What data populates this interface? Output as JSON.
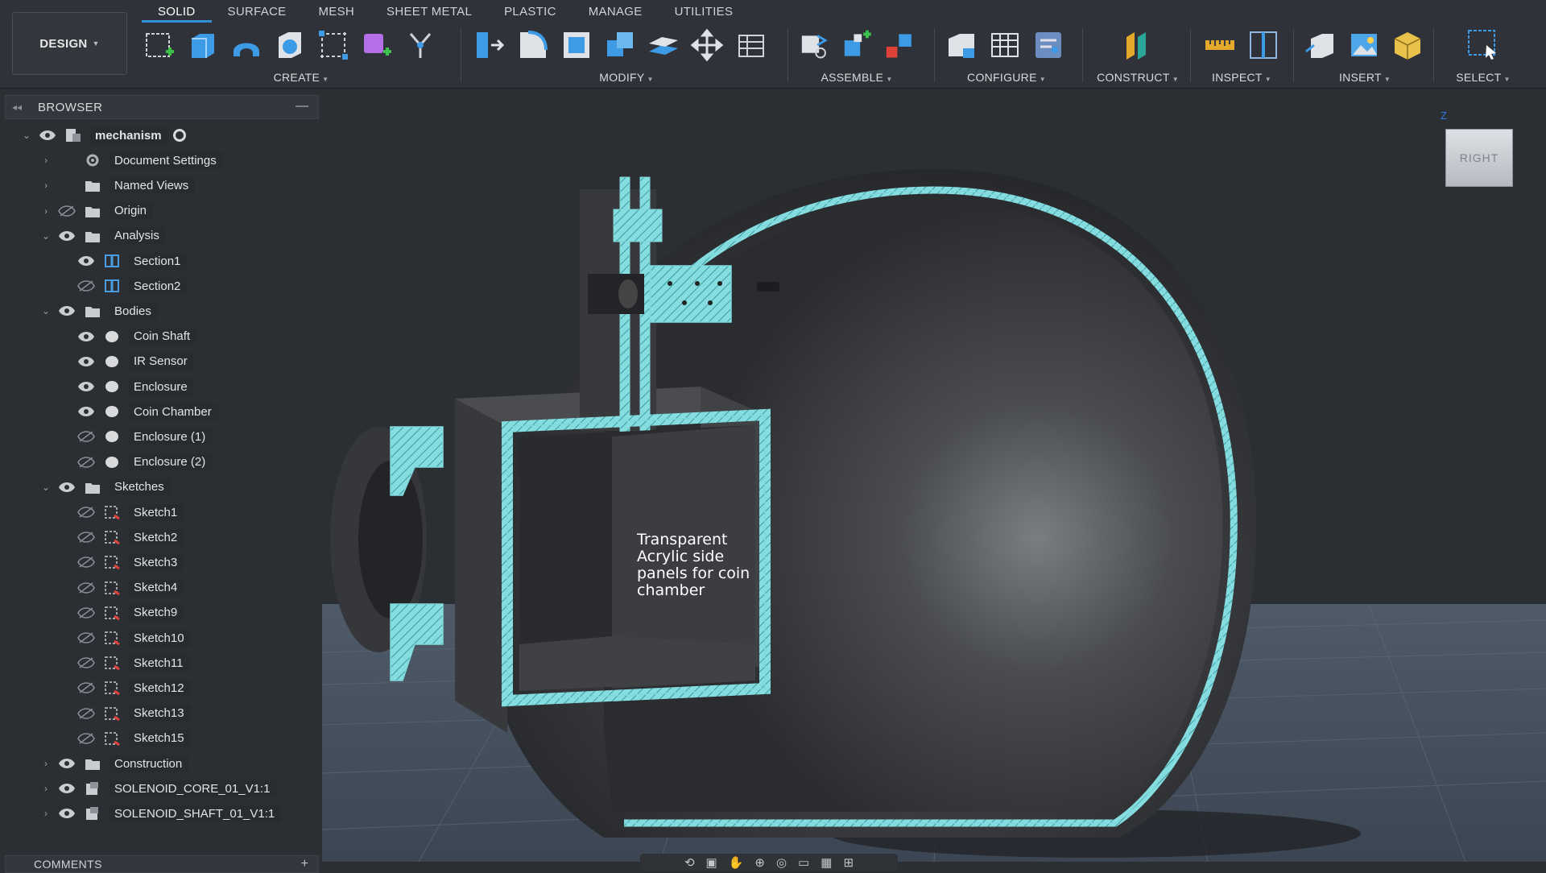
{
  "workspace": {
    "label": "DESIGN"
  },
  "tabs": [
    "SOLID",
    "SURFACE",
    "MESH",
    "SHEET METAL",
    "PLASTIC",
    "MANAGE",
    "UTILITIES"
  ],
  "toolbar_groups": {
    "create": "CREATE",
    "modify": "MODIFY",
    "assemble": "ASSEMBLE",
    "configure": "CONFIGURE",
    "construct": "CONSTRUCT",
    "inspect": "INSPECT",
    "insert": "INSERT",
    "select": "SELECT"
  },
  "browser": {
    "title": "BROWSER",
    "root": "mechanism",
    "items": [
      {
        "label": "Document Settings",
        "icon": "gear-icon"
      },
      {
        "label": "Named Views",
        "icon": "folder-icon"
      },
      {
        "label": "Origin",
        "icon": "folder-icon"
      },
      {
        "label": "Analysis",
        "icon": "folder-icon"
      },
      {
        "label": "Section1",
        "icon": "section-analysis-icon"
      },
      {
        "label": "Section2",
        "icon": "section-analysis-icon"
      },
      {
        "label": "Bodies",
        "icon": "folder-icon"
      },
      {
        "label": "Coin Shaft",
        "icon": "body-icon"
      },
      {
        "label": "IR Sensor",
        "icon": "body-icon"
      },
      {
        "label": "Enclosure",
        "icon": "body-icon"
      },
      {
        "label": "Coin Chamber",
        "icon": "body-icon"
      },
      {
        "label": "Enclosure (1)",
        "icon": "body-icon"
      },
      {
        "label": "Enclosure (2)",
        "icon": "body-icon"
      },
      {
        "label": "Sketches",
        "icon": "folder-icon"
      },
      {
        "label": "Sketch1",
        "icon": "sketch-icon"
      },
      {
        "label": "Sketch2",
        "icon": "sketch-icon"
      },
      {
        "label": "Sketch3",
        "icon": "sketch-icon"
      },
      {
        "label": "Sketch4",
        "icon": "sketch-icon"
      },
      {
        "label": "Sketch9",
        "icon": "sketch-icon"
      },
      {
        "label": "Sketch10",
        "icon": "sketch-icon"
      },
      {
        "label": "Sketch11",
        "icon": "sketch-icon"
      },
      {
        "label": "Sketch12",
        "icon": "sketch-icon"
      },
      {
        "label": "Sketch13",
        "icon": "sketch-icon"
      },
      {
        "label": "Sketch15",
        "icon": "sketch-icon"
      },
      {
        "label": "Construction",
        "icon": "folder-icon"
      },
      {
        "label": "SOLENOID_CORE_01_V1:1",
        "icon": "component-icon"
      },
      {
        "label": "SOLENOID_SHAFT_01_V1:1",
        "icon": "component-icon"
      }
    ]
  },
  "viewport": {
    "annotation": "Transparent Acrylic side panels for coin chamber",
    "viewcube_face": "RIGHT",
    "viewcube_axis": "Z"
  },
  "comments": {
    "title": "COMMENTS"
  },
  "colors": {
    "accent": "#2f8fd8",
    "section_cyan": "#7fd8dc",
    "body_dark": "#3a3c40"
  }
}
